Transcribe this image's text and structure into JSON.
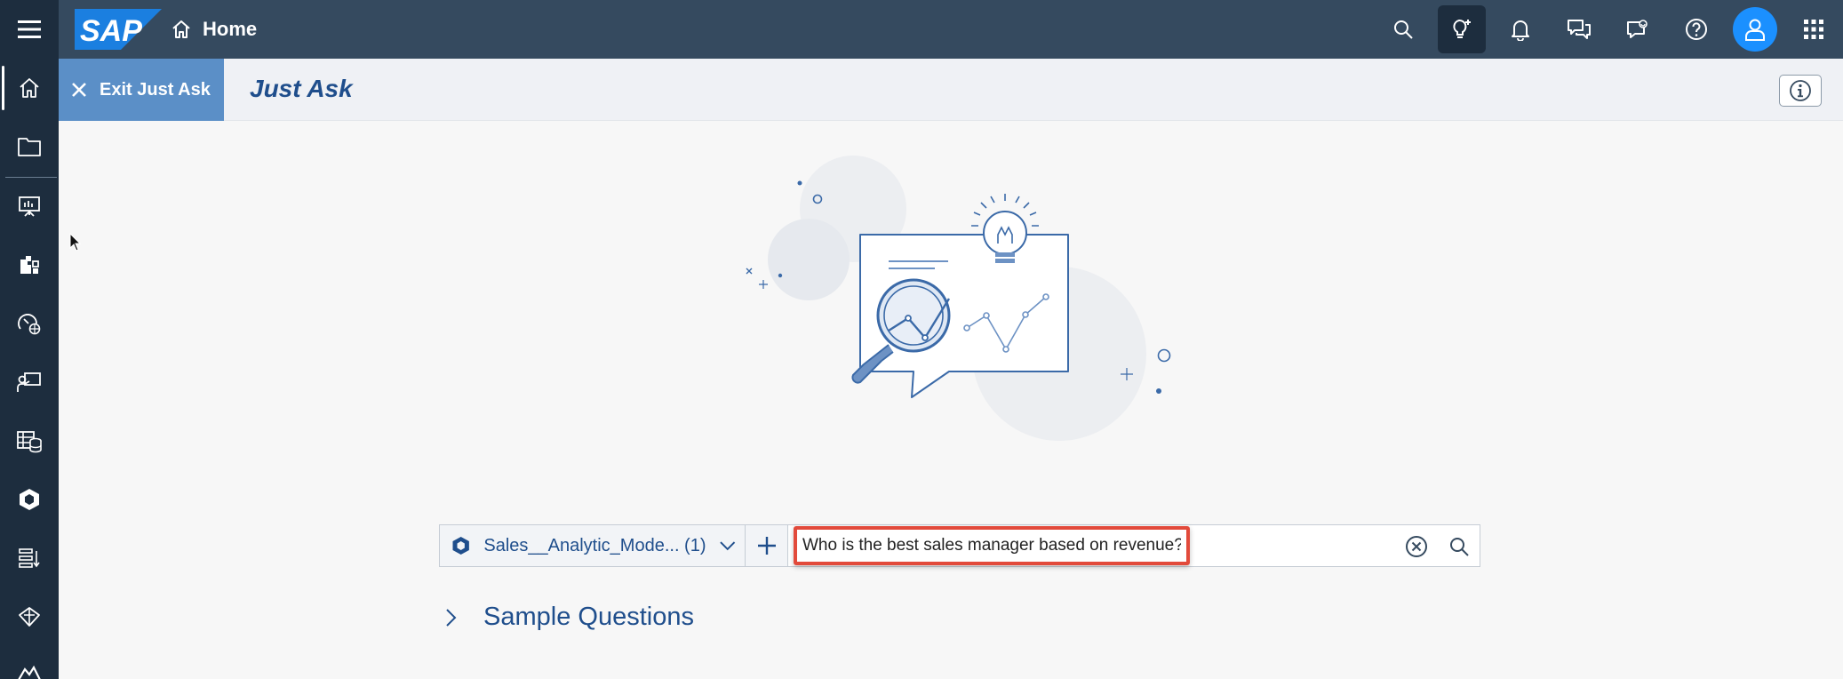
{
  "shell": {
    "logo_text": "SAP",
    "home_label": "Home",
    "actions": [
      "search-icon",
      "just-ask-icon",
      "bell-icon",
      "discussion-icon",
      "feedback-icon",
      "help-icon",
      "user-avatar",
      "product-switch-icon"
    ]
  },
  "sidenav": {
    "items": [
      "home-icon",
      "files-icon",
      "stories-icon",
      "analytic-apps-icon",
      "digital-boardroom-icon",
      "planning-icon",
      "modeler-icon",
      "data-analyzer-icon",
      "data-actions-icon",
      "connections-icon",
      "more-icon"
    ]
  },
  "subheader": {
    "exit_label": "Exit Just Ask",
    "title": "Just Ask"
  },
  "search": {
    "model_label": "Sales__Analytic_Mode... (1)",
    "query_value": "Who is the best sales manager based on revenue?"
  },
  "sample_questions": {
    "label": "Sample Questions"
  },
  "colors": {
    "shell": "#354a5f",
    "sidenav": "#1d2d3e",
    "accent": "#1f4e8c",
    "exit_button": "#5b8fc7",
    "highlight": "#e24a3b",
    "avatar": "#1b90ff"
  }
}
